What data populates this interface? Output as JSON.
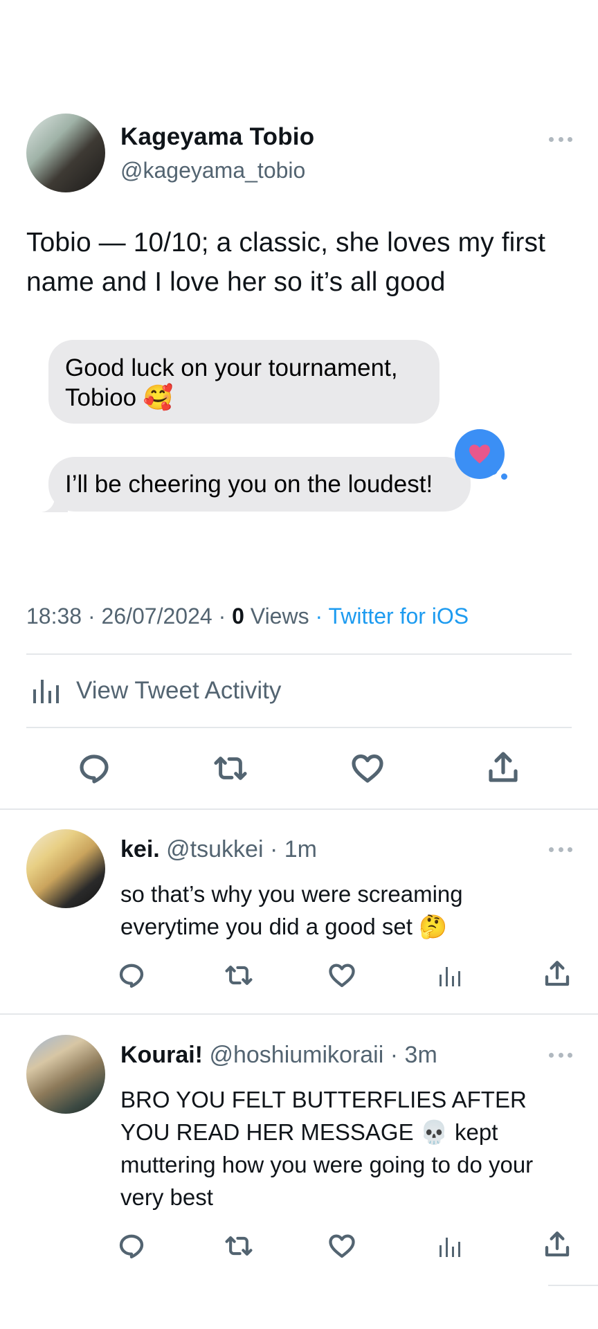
{
  "tweet": {
    "author_name": "Kageyama Tobio",
    "author_handle": "@kageyama_tobio",
    "text": "Tobio — 10/10; a classic, she loves my first name and I love her so it’s all good",
    "messages": [
      "Good luck on your tournament, Tobioo 🥰",
      "I’ll be cheering you on the loudest!"
    ],
    "reaction_icon": "heart-icon",
    "time": "18:38",
    "date": "26/07/2024",
    "views_count": "0",
    "views_label": "Views",
    "source": "Twitter for iOS",
    "activity_label": "View Tweet Activity"
  },
  "replies": [
    {
      "name": "kei.",
      "handle": "@tsukkei",
      "time": "1m",
      "text": "so that’s why you were screaming everytime you did a good set 🤔"
    },
    {
      "name": "Kourai!",
      "handle": "@hoshiumikoraii",
      "time": "3m",
      "text": "BRO YOU FELT BUTTERFLIES AFTER YOU READ HER MESSAGE 💀 kept muttering how you were going to do your very best"
    }
  ],
  "colors": {
    "link": "#1d9bf0",
    "secondary_text": "#536471",
    "bubble": "#e9e9eb",
    "reaction": "#3b8ff5",
    "heart": "#e8578c"
  }
}
